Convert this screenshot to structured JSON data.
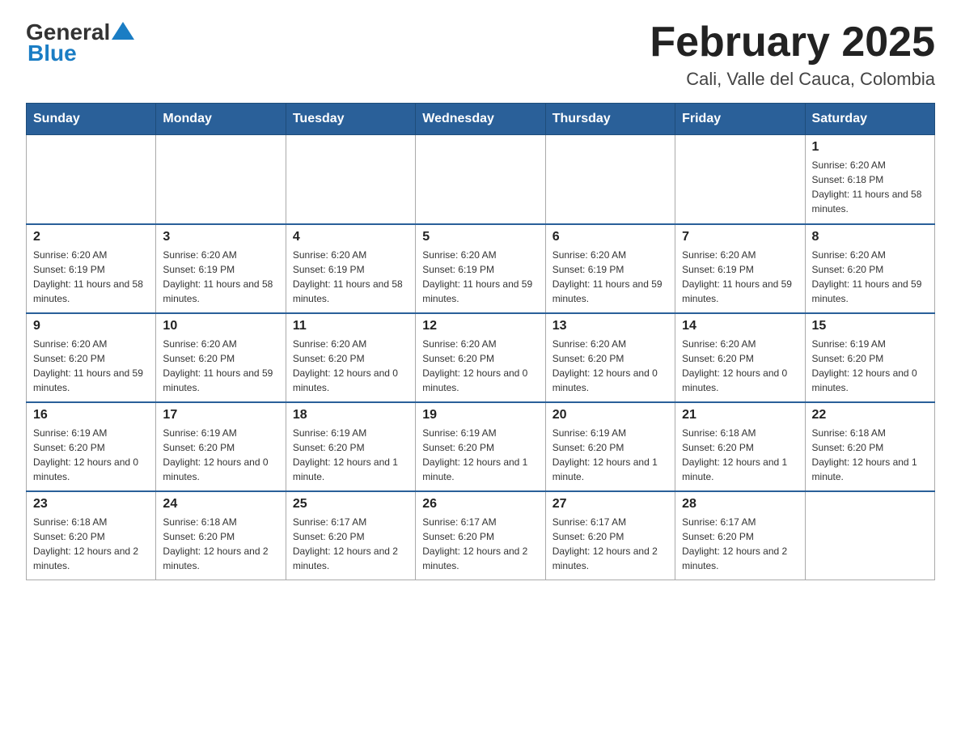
{
  "header": {
    "logo_general": "General",
    "logo_blue": "Blue",
    "month_title": "February 2025",
    "location": "Cali, Valle del Cauca, Colombia"
  },
  "weekdays": [
    "Sunday",
    "Monday",
    "Tuesday",
    "Wednesday",
    "Thursday",
    "Friday",
    "Saturday"
  ],
  "weeks": [
    [
      {
        "day": "",
        "sunrise": "",
        "sunset": "",
        "daylight": ""
      },
      {
        "day": "",
        "sunrise": "",
        "sunset": "",
        "daylight": ""
      },
      {
        "day": "",
        "sunrise": "",
        "sunset": "",
        "daylight": ""
      },
      {
        "day": "",
        "sunrise": "",
        "sunset": "",
        "daylight": ""
      },
      {
        "day": "",
        "sunrise": "",
        "sunset": "",
        "daylight": ""
      },
      {
        "day": "",
        "sunrise": "",
        "sunset": "",
        "daylight": ""
      },
      {
        "day": "1",
        "sunrise": "Sunrise: 6:20 AM",
        "sunset": "Sunset: 6:18 PM",
        "daylight": "Daylight: 11 hours and 58 minutes."
      }
    ],
    [
      {
        "day": "2",
        "sunrise": "Sunrise: 6:20 AM",
        "sunset": "Sunset: 6:19 PM",
        "daylight": "Daylight: 11 hours and 58 minutes."
      },
      {
        "day": "3",
        "sunrise": "Sunrise: 6:20 AM",
        "sunset": "Sunset: 6:19 PM",
        "daylight": "Daylight: 11 hours and 58 minutes."
      },
      {
        "day": "4",
        "sunrise": "Sunrise: 6:20 AM",
        "sunset": "Sunset: 6:19 PM",
        "daylight": "Daylight: 11 hours and 58 minutes."
      },
      {
        "day": "5",
        "sunrise": "Sunrise: 6:20 AM",
        "sunset": "Sunset: 6:19 PM",
        "daylight": "Daylight: 11 hours and 59 minutes."
      },
      {
        "day": "6",
        "sunrise": "Sunrise: 6:20 AM",
        "sunset": "Sunset: 6:19 PM",
        "daylight": "Daylight: 11 hours and 59 minutes."
      },
      {
        "day": "7",
        "sunrise": "Sunrise: 6:20 AM",
        "sunset": "Sunset: 6:19 PM",
        "daylight": "Daylight: 11 hours and 59 minutes."
      },
      {
        "day": "8",
        "sunrise": "Sunrise: 6:20 AM",
        "sunset": "Sunset: 6:20 PM",
        "daylight": "Daylight: 11 hours and 59 minutes."
      }
    ],
    [
      {
        "day": "9",
        "sunrise": "Sunrise: 6:20 AM",
        "sunset": "Sunset: 6:20 PM",
        "daylight": "Daylight: 11 hours and 59 minutes."
      },
      {
        "day": "10",
        "sunrise": "Sunrise: 6:20 AM",
        "sunset": "Sunset: 6:20 PM",
        "daylight": "Daylight: 11 hours and 59 minutes."
      },
      {
        "day": "11",
        "sunrise": "Sunrise: 6:20 AM",
        "sunset": "Sunset: 6:20 PM",
        "daylight": "Daylight: 12 hours and 0 minutes."
      },
      {
        "day": "12",
        "sunrise": "Sunrise: 6:20 AM",
        "sunset": "Sunset: 6:20 PM",
        "daylight": "Daylight: 12 hours and 0 minutes."
      },
      {
        "day": "13",
        "sunrise": "Sunrise: 6:20 AM",
        "sunset": "Sunset: 6:20 PM",
        "daylight": "Daylight: 12 hours and 0 minutes."
      },
      {
        "day": "14",
        "sunrise": "Sunrise: 6:20 AM",
        "sunset": "Sunset: 6:20 PM",
        "daylight": "Daylight: 12 hours and 0 minutes."
      },
      {
        "day": "15",
        "sunrise": "Sunrise: 6:19 AM",
        "sunset": "Sunset: 6:20 PM",
        "daylight": "Daylight: 12 hours and 0 minutes."
      }
    ],
    [
      {
        "day": "16",
        "sunrise": "Sunrise: 6:19 AM",
        "sunset": "Sunset: 6:20 PM",
        "daylight": "Daylight: 12 hours and 0 minutes."
      },
      {
        "day": "17",
        "sunrise": "Sunrise: 6:19 AM",
        "sunset": "Sunset: 6:20 PM",
        "daylight": "Daylight: 12 hours and 0 minutes."
      },
      {
        "day": "18",
        "sunrise": "Sunrise: 6:19 AM",
        "sunset": "Sunset: 6:20 PM",
        "daylight": "Daylight: 12 hours and 1 minute."
      },
      {
        "day": "19",
        "sunrise": "Sunrise: 6:19 AM",
        "sunset": "Sunset: 6:20 PM",
        "daylight": "Daylight: 12 hours and 1 minute."
      },
      {
        "day": "20",
        "sunrise": "Sunrise: 6:19 AM",
        "sunset": "Sunset: 6:20 PM",
        "daylight": "Daylight: 12 hours and 1 minute."
      },
      {
        "day": "21",
        "sunrise": "Sunrise: 6:18 AM",
        "sunset": "Sunset: 6:20 PM",
        "daylight": "Daylight: 12 hours and 1 minute."
      },
      {
        "day": "22",
        "sunrise": "Sunrise: 6:18 AM",
        "sunset": "Sunset: 6:20 PM",
        "daylight": "Daylight: 12 hours and 1 minute."
      }
    ],
    [
      {
        "day": "23",
        "sunrise": "Sunrise: 6:18 AM",
        "sunset": "Sunset: 6:20 PM",
        "daylight": "Daylight: 12 hours and 2 minutes."
      },
      {
        "day": "24",
        "sunrise": "Sunrise: 6:18 AM",
        "sunset": "Sunset: 6:20 PM",
        "daylight": "Daylight: 12 hours and 2 minutes."
      },
      {
        "day": "25",
        "sunrise": "Sunrise: 6:17 AM",
        "sunset": "Sunset: 6:20 PM",
        "daylight": "Daylight: 12 hours and 2 minutes."
      },
      {
        "day": "26",
        "sunrise": "Sunrise: 6:17 AM",
        "sunset": "Sunset: 6:20 PM",
        "daylight": "Daylight: 12 hours and 2 minutes."
      },
      {
        "day": "27",
        "sunrise": "Sunrise: 6:17 AM",
        "sunset": "Sunset: 6:20 PM",
        "daylight": "Daylight: 12 hours and 2 minutes."
      },
      {
        "day": "28",
        "sunrise": "Sunrise: 6:17 AM",
        "sunset": "Sunset: 6:20 PM",
        "daylight": "Daylight: 12 hours and 2 minutes."
      },
      {
        "day": "",
        "sunrise": "",
        "sunset": "",
        "daylight": ""
      }
    ]
  ]
}
